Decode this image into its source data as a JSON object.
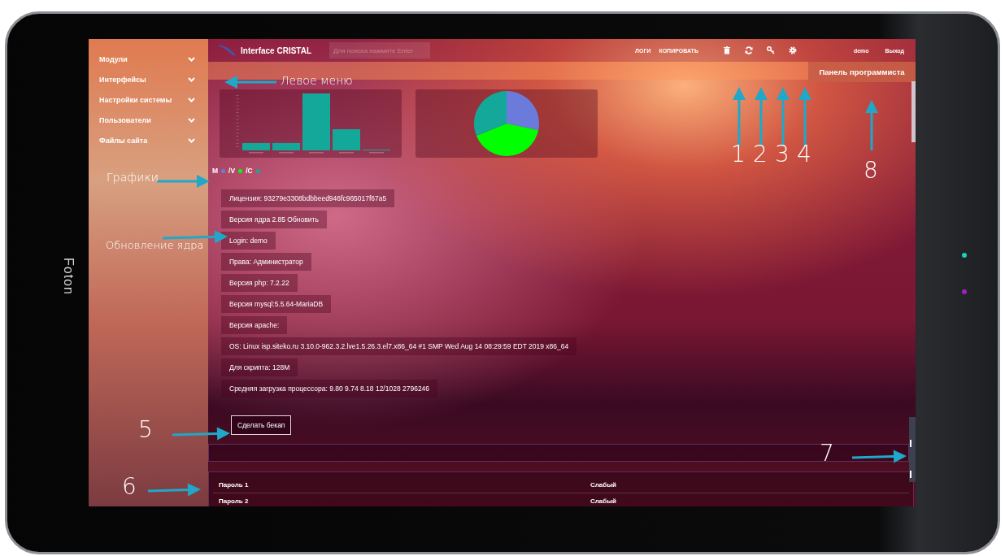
{
  "device": {
    "brand": "Foton"
  },
  "sidebar": {
    "items": [
      {
        "label": "Модули"
      },
      {
        "label": "Интерфейсы"
      },
      {
        "label": "Настройки системы"
      },
      {
        "label": "Пользователи"
      },
      {
        "label": "Файлы сайта"
      }
    ]
  },
  "header": {
    "title": "Interface CRISTAL",
    "search": {
      "placeholder": "Для поиска нажмите Enter"
    },
    "links": [
      "ЛОГИ",
      "КОПИРОВАТЬ"
    ],
    "icons": [
      {
        "kind": "trash"
      },
      {
        "kind": "refresh"
      },
      {
        "kind": "key"
      },
      {
        "kind": "settings"
      }
    ],
    "user": "demo",
    "logout": "Выход"
  },
  "programmer_panel": "Панель программиста",
  "legend": [
    {
      "label": "M",
      "color": "#6b7bdb"
    },
    {
      "label": "/V",
      "color": "#00ff00"
    },
    {
      "label": "/C",
      "color": "#14a89a"
    }
  ],
  "info": [
    "Лицензия: 93279e3308bdbbeed946fc965017f67a5",
    "Версия ядра 2.85 Обновить",
    "Login: demo",
    "Права: Администратор",
    "Версия php: 7.2.22",
    "Версия mysql:5.5.64-MariaDB",
    "Версия apache:",
    "OS: Linux isp.siteko.ru 3.10.0-962.3.2.lve1.5.26.3.el7.x86_64 #1 SMP Wed Aug 14 08:29:59 EDT 2019 x86_64",
    "Для скрипта: 128M",
    "Средняя загрузка процессора: 9.80 9.74 8.18 12/1028 2796246"
  ],
  "backup_button": "Сделать бекап",
  "table": {
    "rows": [
      [
        "Пароль 1",
        "Слабый"
      ],
      [
        "Пароль 2",
        "Слабый"
      ]
    ]
  },
  "annotations": [
    {
      "label": "Левое меню"
    },
    {
      "label": "1"
    },
    {
      "label": "2"
    },
    {
      "label": "3"
    },
    {
      "label": "4"
    },
    {
      "label": "8"
    },
    {
      "label": "Графики"
    },
    {
      "label": "Обновление ядра"
    },
    {
      "label": "5"
    },
    {
      "label": "7"
    },
    {
      "label": "6"
    }
  ]
}
